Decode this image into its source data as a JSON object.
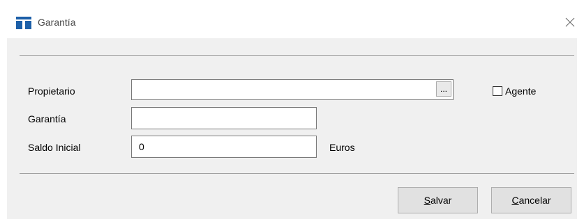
{
  "window": {
    "title": "Garantía",
    "icon": "app-logo-icon",
    "close_icon": "close-icon",
    "accent_color": "#1c5fa8"
  },
  "form": {
    "owner": {
      "label": "Propietario",
      "value": "",
      "browse_label": "..."
    },
    "agent_checkbox": {
      "label": "Agente",
      "checked": false
    },
    "guarantee": {
      "label": "Garantía",
      "value": ""
    },
    "initial_balance": {
      "label": "Saldo Inicial",
      "value": "0",
      "unit": "Euros"
    }
  },
  "buttons": {
    "save": {
      "accel": "S",
      "rest": "alvar"
    },
    "cancel": {
      "accel": "C",
      "rest": "ancelar"
    }
  }
}
